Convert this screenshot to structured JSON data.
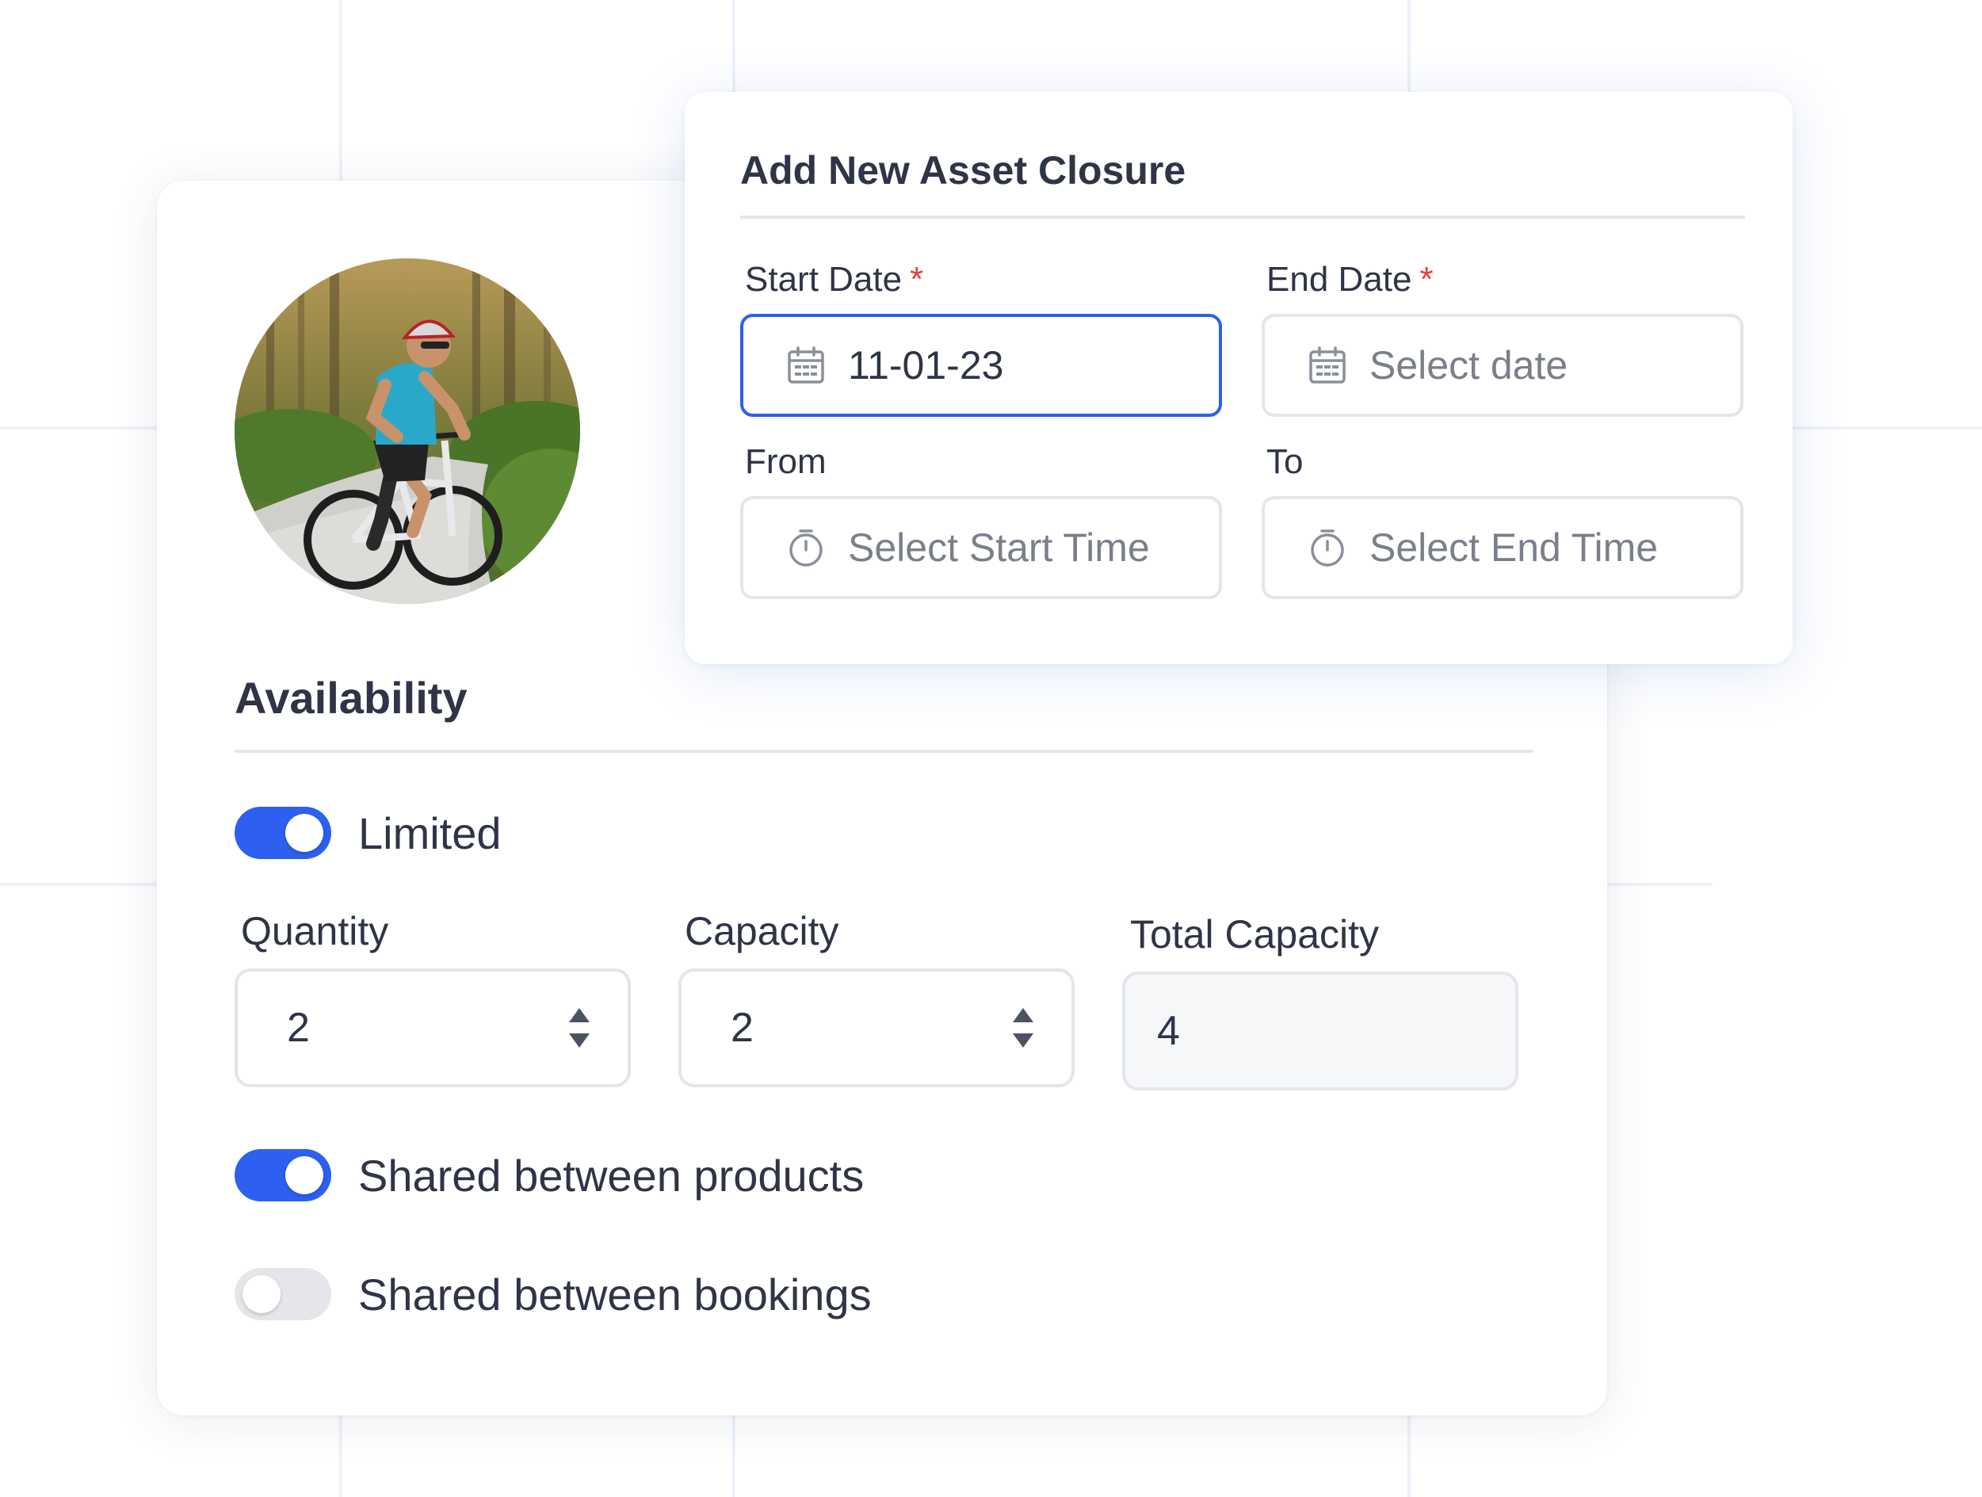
{
  "closure_dialog": {
    "title": "Add New Asset Closure",
    "start_date": {
      "label": "Start Date",
      "required_marker": "*",
      "value": "11-01-23",
      "icon": "calendar-icon"
    },
    "end_date": {
      "label": "End Date",
      "required_marker": "*",
      "placeholder": "Select date",
      "icon": "calendar-icon"
    },
    "from_time": {
      "label": "From",
      "placeholder": "Select Start Time",
      "icon": "stopwatch-icon"
    },
    "to_time": {
      "label": "To",
      "placeholder": "Select End Time",
      "icon": "stopwatch-icon"
    }
  },
  "availability": {
    "title": "Availability",
    "limited": {
      "label": "Limited",
      "on": true
    },
    "quantity": {
      "label": "Quantity",
      "value": "2"
    },
    "capacity": {
      "label": "Capacity",
      "value": "2"
    },
    "total_capacity": {
      "label": "Total Capacity",
      "value": "4"
    },
    "shared_products": {
      "label": "Shared between products",
      "on": true
    },
    "shared_bookings": {
      "label": "Shared between bookings",
      "on": false
    }
  },
  "colors": {
    "accent": "#2d5ff1",
    "required": "#e53e3e",
    "text": "#2f3446",
    "placeholder": "#7a7f8a",
    "border": "#e3e6eb"
  }
}
